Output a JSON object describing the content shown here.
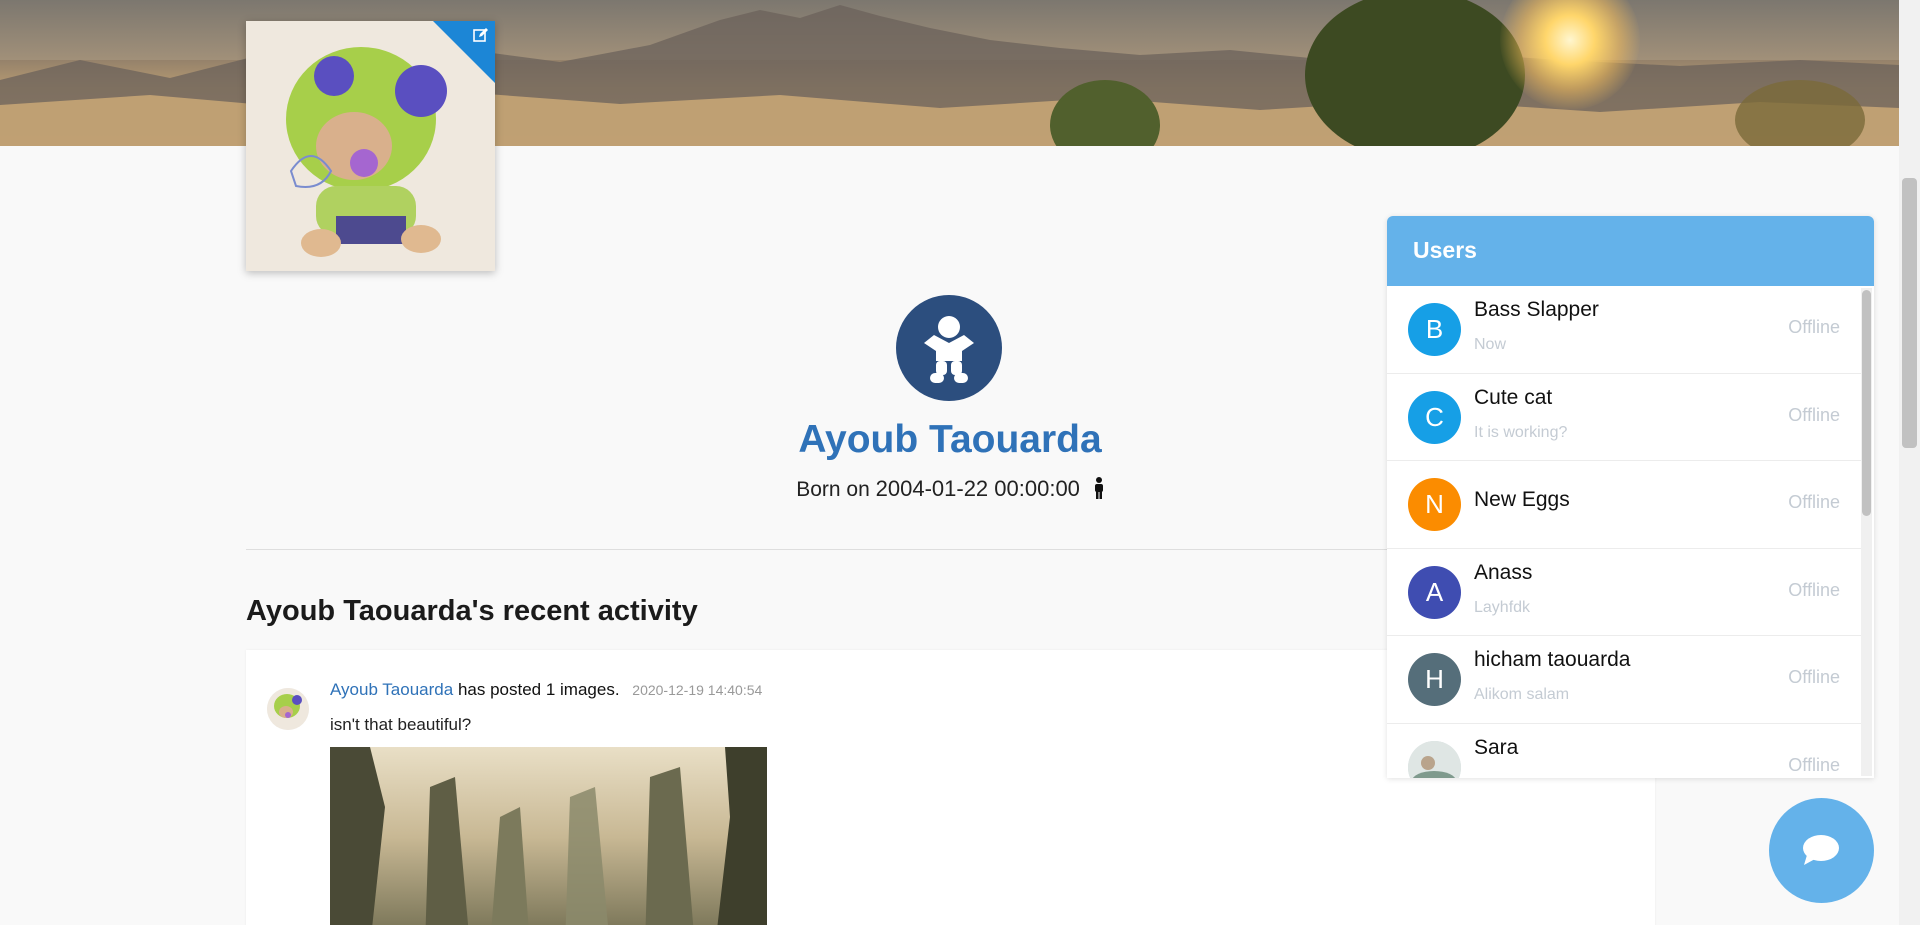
{
  "profile": {
    "name": "Ayoub Taouarda",
    "born_label": "Born on",
    "born_date": "2004-01-22 00:00:00"
  },
  "activity": {
    "title": "Ayoub Taouarda's recent activity",
    "posts": [
      {
        "author": "Ayoub Taouarda",
        "action": "has posted 1 images.",
        "time": "2020-12-19 14:40:54",
        "text": "isn't that beautiful?"
      }
    ]
  },
  "users_panel": {
    "title": "Users",
    "users": [
      {
        "initial": "B",
        "name": "Bass Slapper",
        "message": "Now",
        "status": "Offline",
        "color": "#169fe6"
      },
      {
        "initial": "C",
        "name": "Cute cat",
        "message": "It is working?",
        "status": "Offline",
        "color": "#169fe6"
      },
      {
        "initial": "N",
        "name": "New Eggs",
        "message": "",
        "status": "Offline",
        "color": "#fb8c00"
      },
      {
        "initial": "A",
        "name": "Anass",
        "message": "Layhfdk",
        "status": "Offline",
        "color": "#3f4db1"
      },
      {
        "initial": "H",
        "name": "hicham taouarda",
        "message": "Alikom salam",
        "status": "Offline",
        "color": "#556e7a"
      },
      {
        "initial": "",
        "name": "Sara",
        "message": "",
        "status": "Offline",
        "color": "#cfd8dc"
      }
    ]
  },
  "icons": {
    "edit": "edit-icon",
    "baby": "baby-icon",
    "male": "male-icon",
    "chat": "chat-bubble-icon"
  },
  "colors": {
    "accent": "#64b2ea",
    "name_link": "#2f72b8",
    "baby_circle": "#2c4e7e"
  }
}
